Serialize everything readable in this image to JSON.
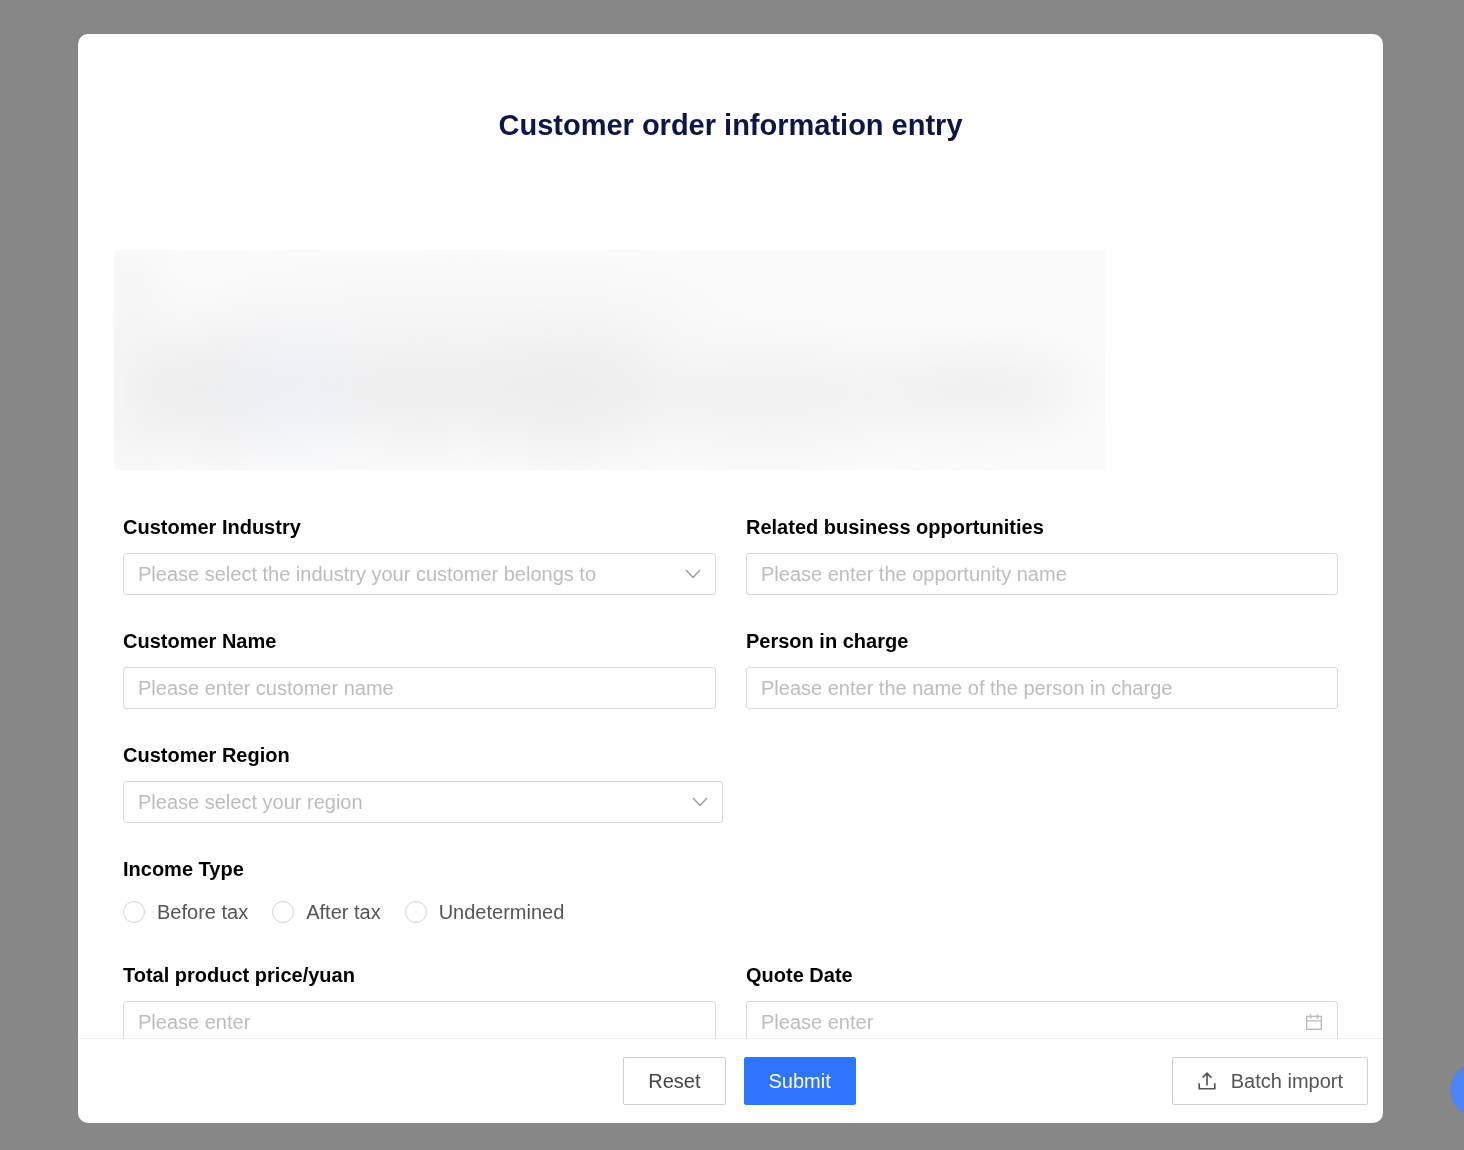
{
  "dialog": {
    "title": "Customer order information entry",
    "rows": [
      [
        {
          "label": "Customer Industry",
          "kind": "select",
          "placeholder": "Please select the industry your customer belongs to"
        },
        {
          "label": "Related business opportunities",
          "kind": "text",
          "placeholder": "Please enter the opportunity name"
        }
      ],
      [
        {
          "label": "Customer Name",
          "kind": "text",
          "placeholder": "Please enter customer name"
        },
        {
          "label": "Person in charge",
          "kind": "text",
          "placeholder": "Please enter the name of the person in charge"
        }
      ],
      [
        {
          "label": "Customer Region",
          "kind": "select",
          "placeholder": "Please select your region"
        }
      ],
      [
        {
          "label": "Income Type",
          "kind": "radio",
          "options": [
            {
              "label": "Before tax",
              "selected": false
            },
            {
              "label": "After tax",
              "selected": false
            },
            {
              "label": "Undetermined",
              "selected": false
            }
          ]
        }
      ],
      [
        {
          "label": "Total product price/yuan",
          "kind": "text",
          "placeholder": "Please enter"
        },
        {
          "label": "Quote Date",
          "kind": "date",
          "placeholder": "Please enter"
        }
      ]
    ],
    "buttons": [
      {
        "label": "Reset",
        "kind": "default"
      },
      {
        "label": "Submit",
        "kind": "primary"
      }
    ],
    "import_button": {
      "label": "Batch import"
    }
  }
}
